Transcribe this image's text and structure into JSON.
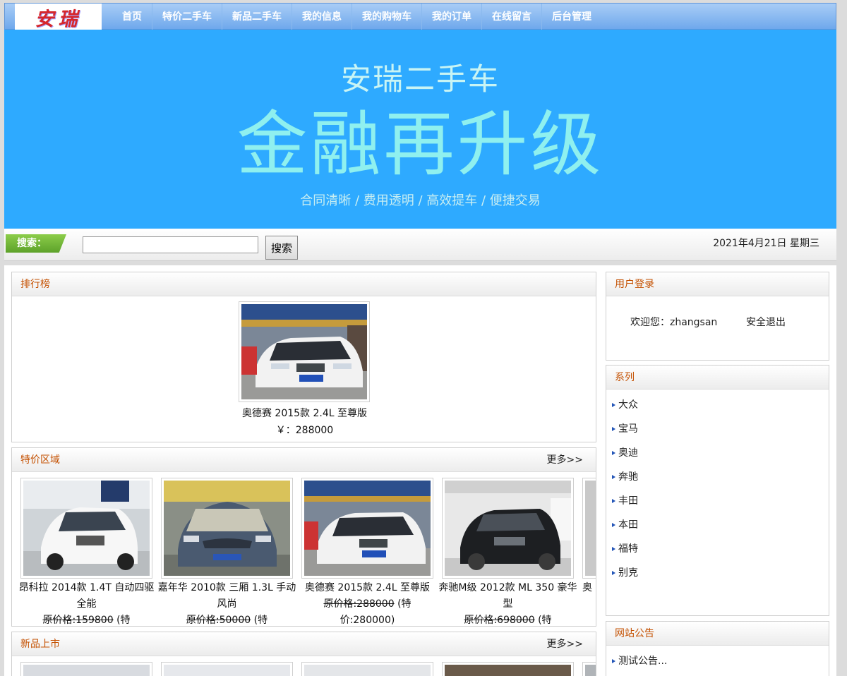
{
  "logo": {
    "text": "安瑞"
  },
  "nav": {
    "items": [
      "首页",
      "特价二手车",
      "新品二手车",
      "我的信息",
      "我的购物车",
      "我的订单",
      "在线留言",
      "后台管理"
    ]
  },
  "banner": {
    "line1": "安瑞二手车",
    "line2": "金融再升级",
    "line3": "合同清晰 / 费用透明 / 高效提车 /  便捷交易"
  },
  "search": {
    "tag": "搜索：",
    "value": "",
    "button": "搜索",
    "date": "2021年4月21日 星期三"
  },
  "ranking": {
    "title": "排行榜",
    "car_name": "奥德赛 2015款 2.4L 至尊版",
    "price": "￥：288000"
  },
  "special": {
    "title": "特价区域",
    "more": "更多>>",
    "cars": [
      {
        "name": "昂科拉 2014款 1.4T 自动四驱全能",
        "old_price": "原价格:159800",
        "special": " (特"
      },
      {
        "name": "嘉年华 2010款 三厢 1.3L 手动风尚",
        "old_price": "原价格:50000",
        "special": " (特"
      },
      {
        "name": "奥德赛 2015款 2.4L 至尊版",
        "old_price": "原价格:288000",
        "special": " (特价:280000)"
      },
      {
        "name": "奔驰M级 2012款 ML 350 豪华型",
        "old_price": "原价格:698000",
        "special": " (特"
      },
      {
        "name": "奥",
        "old_price": "",
        "special": ""
      }
    ]
  },
  "newcars": {
    "title": "新品上市",
    "more": "更多>>"
  },
  "login": {
    "title": "用户登录",
    "welcome": "欢迎您：zhangsan",
    "logout": "安全退出"
  },
  "series": {
    "title": "系列",
    "items": [
      "大众",
      "宝马",
      "奥迪",
      "奔驰",
      "丰田",
      "本田",
      "福特",
      "别克"
    ]
  },
  "notice": {
    "title": "网站公告",
    "items": [
      "测试公告..."
    ]
  },
  "colors": {
    "nav": "#6fa8ec",
    "banner": "#2eaaff",
    "heading": "#c45000"
  }
}
